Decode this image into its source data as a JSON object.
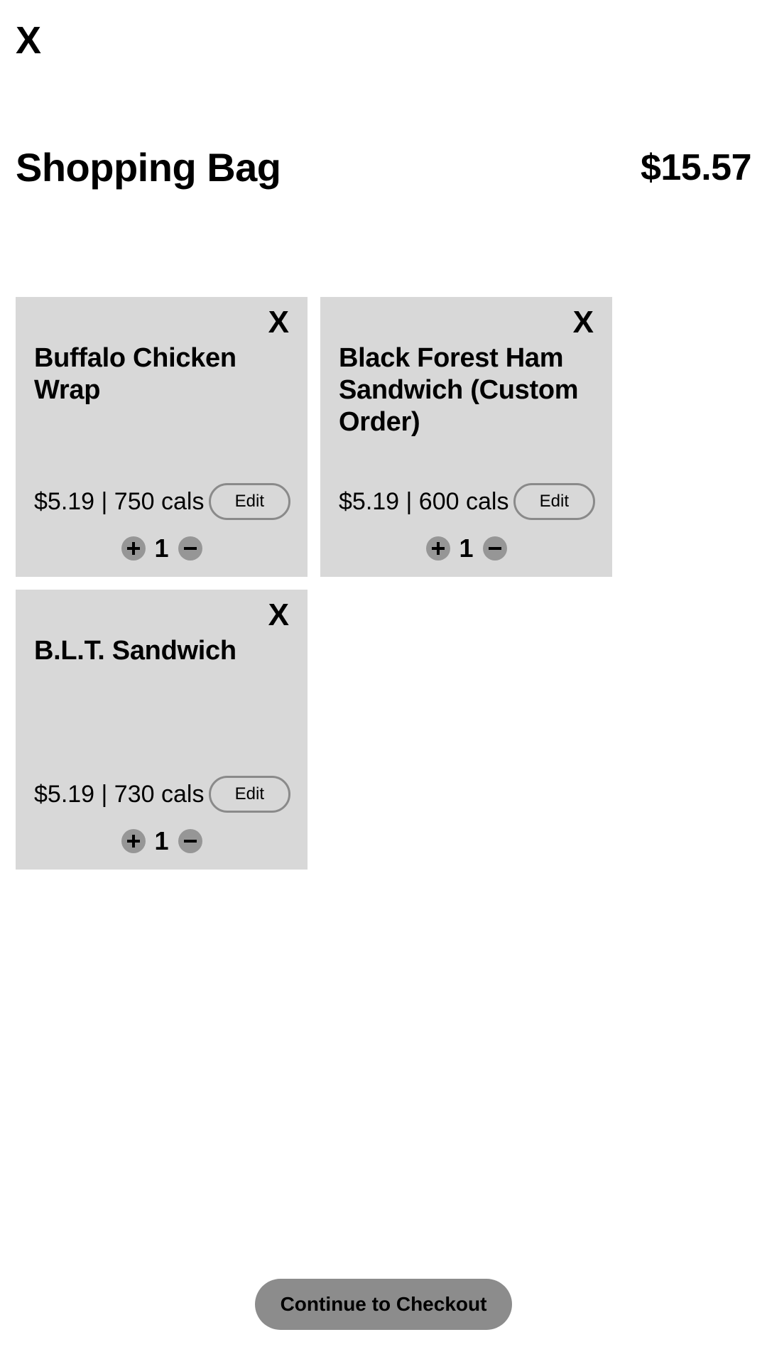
{
  "header": {
    "close_label": "X",
    "title": "Shopping Bag",
    "total": "$15.57"
  },
  "items": [
    {
      "close_label": "X",
      "name": "Buffalo Chicken Wrap",
      "meta": "$5.19 | 750 cals",
      "price": "$5.19",
      "calories": "750 cals",
      "edit_label": "Edit",
      "quantity": "1",
      "increase_label": "+",
      "decrease_label": "-"
    },
    {
      "close_label": "X",
      "name": "Black Forest Ham Sandwich (Custom Order)",
      "meta": "$5.19 | 600 cals",
      "price": "$5.19",
      "calories": "600 cals",
      "edit_label": "Edit",
      "quantity": "1",
      "increase_label": "+",
      "decrease_label": "-"
    },
    {
      "close_label": "X",
      "name": "B.L.T. Sandwich",
      "meta": "$5.19 | 730 cals",
      "price": "$5.19",
      "calories": "730 cals",
      "edit_label": "Edit",
      "quantity": "1",
      "increase_label": "+",
      "decrease_label": "-"
    }
  ],
  "footer": {
    "checkout_label": "Continue to Checkout"
  },
  "colors": {
    "page_background": "#ffffff",
    "card_background": "#d8d8d8",
    "stepper_button": "#969696",
    "edit_border": "#8a8a8a",
    "checkout_background": "#8c8c8c",
    "text": "#000000"
  }
}
